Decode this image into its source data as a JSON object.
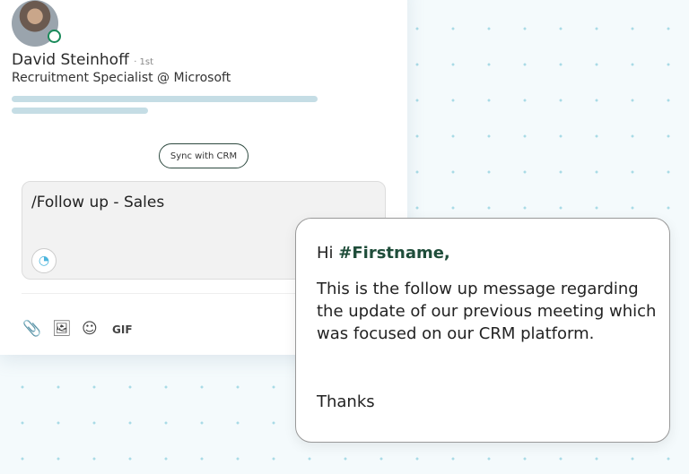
{
  "profile": {
    "name": "David Steinhoff",
    "degree": "· 1st",
    "headline": "Recruitment Specialist @ Microsoft",
    "online": true
  },
  "sync_button": "Sync with CRM",
  "composer": {
    "text": "/Follow up - Sales",
    "toolbar": {
      "attach": "paperclip-icon",
      "image": "image-icon",
      "emoji": "emoji-icon",
      "gif": "GIF"
    }
  },
  "message": {
    "greeting": "Hi ",
    "variable": "#Firstname,",
    "body": "This is the follow up message regarding the update of our previous meeting which was focused on our CRM platform.",
    "closing": "Thanks"
  },
  "colors": {
    "accent": "#1f4d3a",
    "online": "#1a8a5a"
  }
}
